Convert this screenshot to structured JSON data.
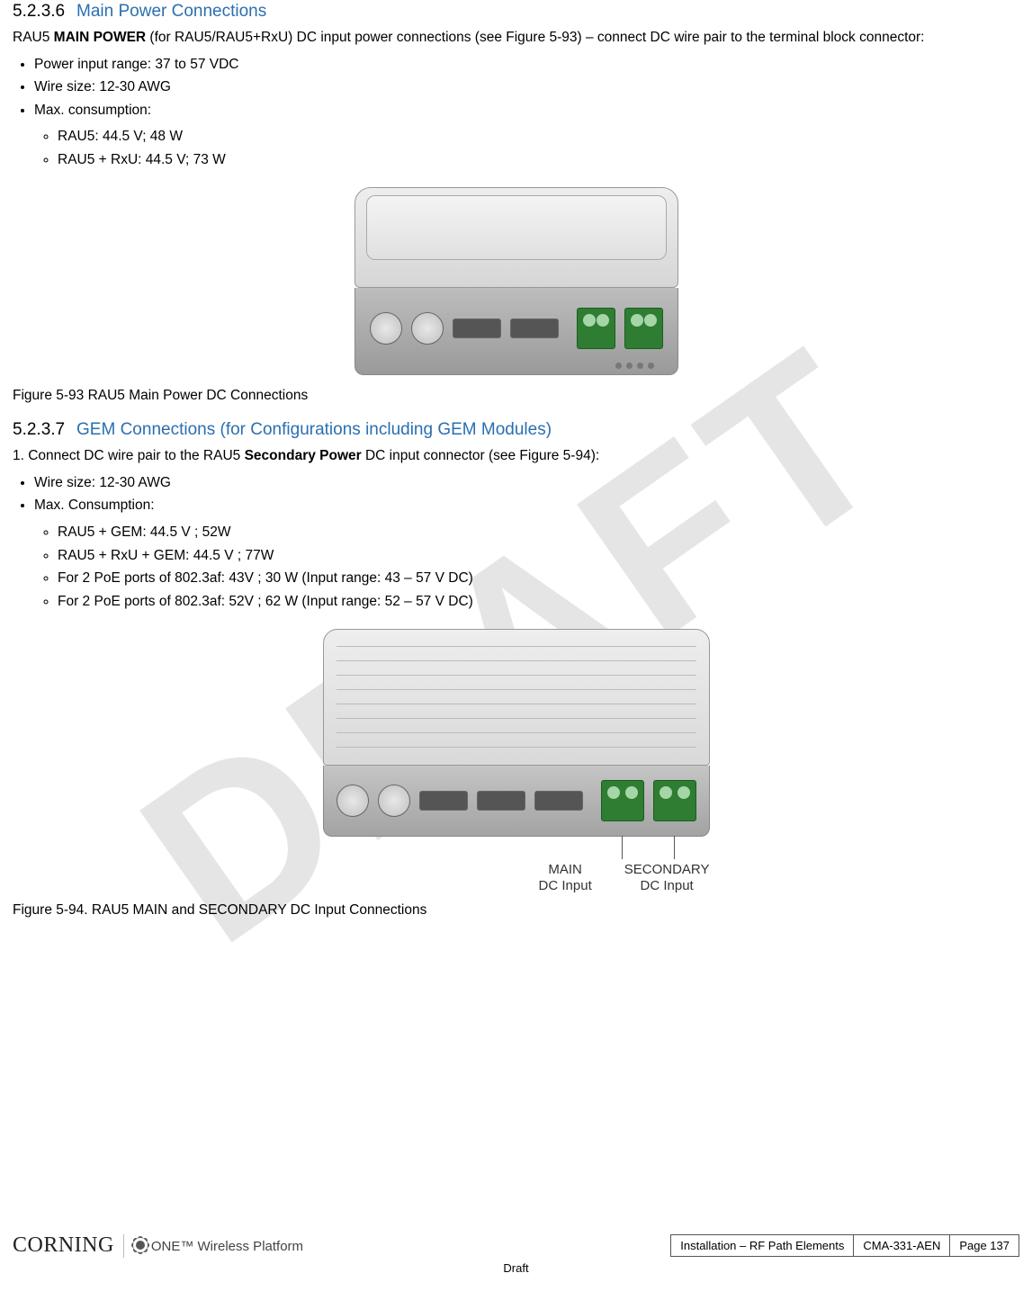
{
  "watermark": "DRAFT",
  "section1": {
    "num": "5.2.3.6",
    "title": "Main Power Connections",
    "intro_pre": "RAU5 ",
    "intro_bold": "MAIN POWER",
    "intro_post": " (for RAU5/RAU5+RxU) DC input power connections (see Figure 5-93) – connect DC wire pair to the terminal block connector:",
    "bullets": [
      "Power input range: 37 to 57 VDC",
      "Wire size: 12-30 AWG",
      "Max. consumption:"
    ],
    "sub_bullets": [
      "RAU5: 44.5 V; 48 W",
      "RAU5 + RxU: 44.5 V; 73 W"
    ],
    "fig_caption": "Figure 5-93 RAU5 Main Power DC Connections"
  },
  "section2": {
    "num": "5.2.3.7",
    "title": "GEM Connections (for Configurations including GEM Modules)",
    "step_pre": "1.  Connect DC wire pair to the RAU5 ",
    "step_bold": "Secondary Power",
    "step_post": " DC input connector (see Figure 5-94):",
    "bullets": [
      "Wire size: 12-30 AWG",
      "Max. Consumption:"
    ],
    "sub_bullets": [
      "RAU5 + GEM: 44.5 V ; 52W",
      "RAU5 + RxU + GEM: 44.5 V ; 77W",
      "For 2 PoE ports of 802.3af: 43V ; 30 W (Input range: 43 – 57 V DC)",
      "For 2 PoE ports of 802.3af: 52V ; 62 W (Input range: 52 – 57 V DC)"
    ],
    "fig_caption": "Figure 5-94. RAU5 MAIN and SECONDARY DC Input Connections",
    "label_main_top": "MAIN",
    "label_main_bot": "DC Input",
    "label_sec_top": "SECONDARY",
    "label_sec_bot": "DC Input"
  },
  "footer": {
    "brand": "CORNING",
    "product": "ONE™ Wireless Platform",
    "cell1": "Installation – RF Path Elements",
    "cell2": "CMA-331-AEN",
    "cell3": "Page 137",
    "draft": "Draft"
  }
}
